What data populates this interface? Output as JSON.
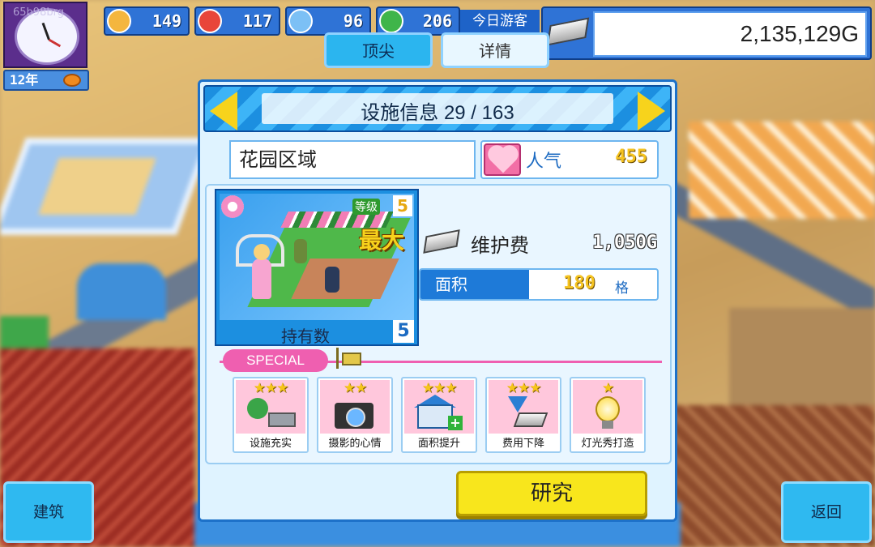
{
  "hud": {
    "watermark": "65b98brg",
    "year": "12年",
    "stats": [
      {
        "icon": "happy-face-icon",
        "value": "149",
        "color": "#f4b63e"
      },
      {
        "icon": "fire-spirit-icon",
        "value": "117",
        "color": "#e8463a"
      },
      {
        "icon": "water-drop-icon",
        "value": "96",
        "color": "#7cc0f5"
      },
      {
        "icon": "clover-icon",
        "value": "206",
        "color": "#3fb54a"
      }
    ],
    "visitors_label": "今日游客",
    "money": "2,135,129G"
  },
  "tabs": {
    "top": "顶尖",
    "detail": "详情"
  },
  "panel": {
    "title": "设施信息 29 / 163",
    "facility_name": "花园区域",
    "popularity_label": "人气",
    "popularity_value": "455",
    "level_label": "等级",
    "level_value": "5",
    "max_badge": "最大",
    "owned_label": "持有数",
    "owned_value": "5",
    "maintenance_label": "维护费",
    "maintenance_value": "1,050G",
    "area_label": "面积",
    "area_value": "180",
    "area_unit": "格",
    "special_label": "SPECIAL",
    "skills": [
      {
        "label": "设施充实",
        "stars": "★★★",
        "icon": "tree-bench-icon"
      },
      {
        "label": "摄影的心情",
        "stars": "★★",
        "icon": "camera-icon"
      },
      {
        "label": "面积提升",
        "stars": "★★★",
        "icon": "house-plus-icon"
      },
      {
        "label": "费用下降",
        "stars": "★★★",
        "icon": "cost-down-icon"
      },
      {
        "label": "灯光秀打造",
        "stars": "★",
        "icon": "light-bulb-icon"
      }
    ],
    "research_button": "研究"
  },
  "buttons": {
    "build": "建筑",
    "back": "返回"
  },
  "colors": {
    "panel_blue": "#1d71c9",
    "accent_yellow": "#f8e61c",
    "special_pink": "#ef5fb0"
  }
}
